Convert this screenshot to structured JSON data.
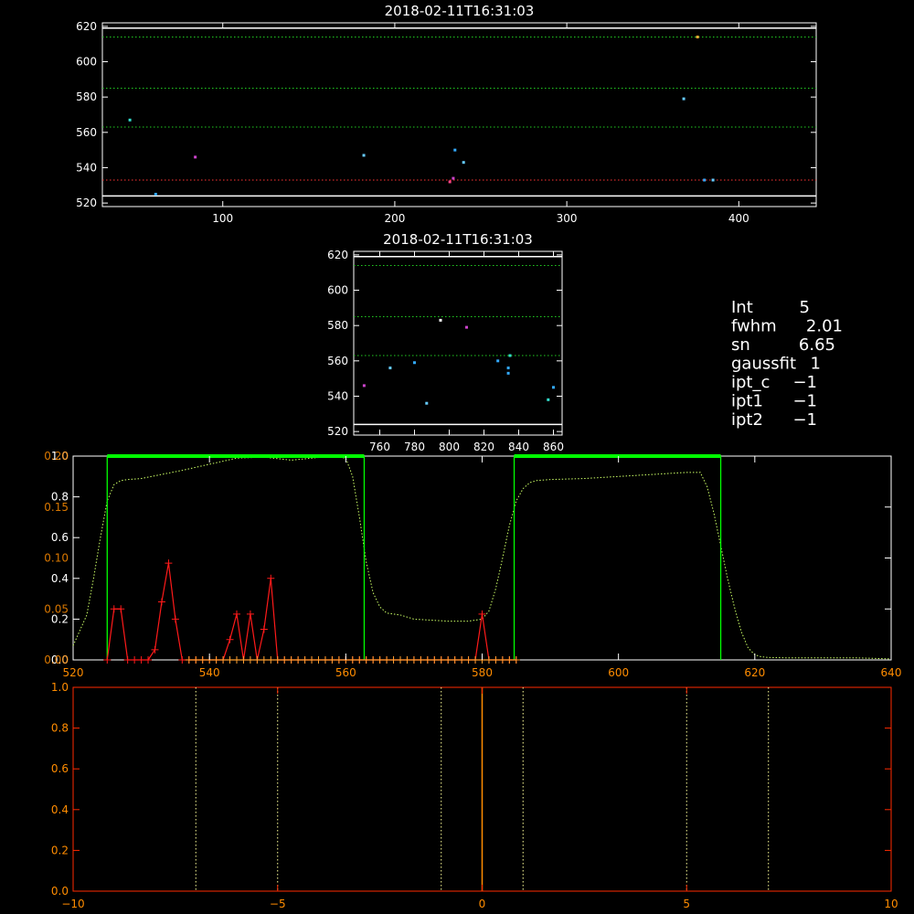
{
  "colors": {
    "background": "#000000",
    "axis_white": "#ffffff",
    "axis_red": "#ff2a00",
    "axis_orange": "#ff8c00",
    "green_bright": "#00ff00",
    "green_dotted": "#22cc22",
    "yellow_green": "#ccff66",
    "red_line": "#ff1a1a",
    "orange_line": "#ffa030",
    "red_dotted": "#ff3333",
    "white_dotted": "#ffff99"
  },
  "stats": {
    "rows": [
      {
        "label": "Int",
        "value": "5"
      },
      {
        "label": "fwhm",
        "value": "2.01"
      },
      {
        "label": "sn",
        "value": "6.65"
      },
      {
        "label": "gaussfit",
        "value": "1"
      },
      {
        "label": "ipt_c",
        "value": "−1"
      },
      {
        "label": "ipt1",
        "value": "−1"
      },
      {
        "label": "ipt2",
        "value": "−1"
      }
    ]
  },
  "chart_data": [
    {
      "type": "scatter",
      "title": "2018-02-11T16:31:03",
      "xlim": [
        30,
        445
      ],
      "ylim": [
        518,
        622
      ],
      "xticks": [
        100,
        200,
        300,
        400
      ],
      "yticks": [
        520,
        540,
        560,
        580,
        600,
        620
      ],
      "hlines": [
        {
          "y": 614,
          "color": "#22cc22",
          "style": "dotted"
        },
        {
          "y": 585,
          "color": "#22cc22",
          "style": "dotted"
        },
        {
          "y": 563,
          "color": "#22cc22",
          "style": "dotted"
        },
        {
          "y": 533,
          "color": "#ff3333",
          "style": "dotted"
        },
        {
          "y": 524,
          "color": "#ffffff",
          "style": "solid"
        },
        {
          "y": 619,
          "color": "#ffffff",
          "style": "solid"
        }
      ],
      "points": [
        {
          "x": 46,
          "y": 567,
          "color": "#33ddcc"
        },
        {
          "x": 61,
          "y": 525,
          "color": "#33aaff"
        },
        {
          "x": 84,
          "y": 546,
          "color": "#cc44cc"
        },
        {
          "x": 182,
          "y": 547,
          "color": "#66ccff"
        },
        {
          "x": 232,
          "y": 532,
          "color": "#ff4488"
        },
        {
          "x": 234,
          "y": 534,
          "color": "#cc44cc"
        },
        {
          "x": 235,
          "y": 550,
          "color": "#33aaff"
        },
        {
          "x": 240,
          "y": 543,
          "color": "#66ccff"
        },
        {
          "x": 368,
          "y": 579,
          "color": "#66ccff"
        },
        {
          "x": 376,
          "y": 614,
          "color": "#ffaa33"
        },
        {
          "x": 380,
          "y": 533,
          "color": "#33aaff"
        },
        {
          "x": 385,
          "y": 533,
          "color": "#66ccff"
        }
      ]
    },
    {
      "type": "scatter",
      "title": "2018-02-11T16:31:03",
      "xlim": [
        745,
        865
      ],
      "ylim": [
        518,
        622
      ],
      "xticks": [
        760,
        780,
        800,
        820,
        840,
        860
      ],
      "yticks": [
        520,
        540,
        560,
        580,
        600,
        620
      ],
      "hlines": [
        {
          "y": 614,
          "color": "#22cc22",
          "style": "dotted"
        },
        {
          "y": 585,
          "color": "#22cc22",
          "style": "dotted"
        },
        {
          "y": 563,
          "color": "#22cc22",
          "style": "dotted"
        },
        {
          "y": 524,
          "color": "#ffffff",
          "style": "solid"
        },
        {
          "y": 619,
          "color": "#ffffff",
          "style": "solid"
        }
      ],
      "points": [
        {
          "x": 751,
          "y": 546,
          "color": "#cc44cc"
        },
        {
          "x": 766,
          "y": 556,
          "color": "#66ccff"
        },
        {
          "x": 780,
          "y": 559,
          "color": "#33aaff"
        },
        {
          "x": 787,
          "y": 536,
          "color": "#66ccff"
        },
        {
          "x": 795,
          "y": 583,
          "color": "#ffffff"
        },
        {
          "x": 810,
          "y": 579,
          "color": "#cc44cc"
        },
        {
          "x": 828,
          "y": 560,
          "color": "#33aaff"
        },
        {
          "x": 834,
          "y": 553,
          "color": "#33aaff"
        },
        {
          "x": 834,
          "y": 556,
          "color": "#33aaff"
        },
        {
          "x": 835,
          "y": 563,
          "color": "#33ddcc"
        },
        {
          "x": 857,
          "y": 538,
          "color": "#33ddcc"
        },
        {
          "x": 860,
          "y": 545,
          "color": "#33aaff"
        }
      ]
    },
    {
      "type": "line",
      "xlim": [
        520,
        640
      ],
      "ylim_left": [
        0,
        1.0
      ],
      "ylim_right": [
        0,
        0.2
      ],
      "xticks": [
        520,
        540,
        560,
        580,
        600,
        620,
        640
      ],
      "yticks_left": [
        0.0,
        0.2,
        0.4,
        0.6,
        0.8,
        1.0
      ],
      "yticklabels_left": [
        "0.0",
        "0.2",
        "0.4",
        "0.6",
        "0.8",
        "1.0"
      ],
      "yticks_right": [
        0.0,
        0.05,
        0.1,
        0.15,
        0.2
      ],
      "yticklabels_right": [
        "0.00",
        "0.05",
        "0.10",
        "0.15",
        "0.20"
      ],
      "bandpass_windows": [
        {
          "x0": 525.0,
          "x1": 562.7
        },
        {
          "x0": 584.7,
          "x1": 615.0
        }
      ],
      "transmission_curve": {
        "x": [
          520,
          522,
          523,
          524,
          525,
          526,
          527,
          528,
          530,
          533,
          536,
          540,
          544,
          548,
          552,
          555,
          558,
          560,
          561,
          562,
          563,
          564,
          565,
          566,
          568,
          570,
          575,
          578,
          580,
          581,
          582,
          583,
          584,
          585,
          586,
          587,
          588,
          590,
          595,
          600,
          605,
          610,
          612,
          613,
          614,
          615,
          616,
          617,
          618,
          619,
          620,
          621,
          622,
          625,
          630,
          635,
          640
        ],
        "y": [
          0.07,
          0.22,
          0.4,
          0.6,
          0.78,
          0.86,
          0.88,
          0.885,
          0.89,
          0.91,
          0.93,
          0.96,
          0.99,
          0.995,
          0.98,
          0.99,
          1.0,
          0.99,
          0.9,
          0.7,
          0.48,
          0.33,
          0.26,
          0.23,
          0.22,
          0.2,
          0.19,
          0.19,
          0.2,
          0.24,
          0.35,
          0.5,
          0.66,
          0.78,
          0.84,
          0.87,
          0.88,
          0.885,
          0.89,
          0.9,
          0.91,
          0.92,
          0.92,
          0.85,
          0.72,
          0.56,
          0.4,
          0.26,
          0.14,
          0.06,
          0.025,
          0.015,
          0.012,
          0.01,
          0.01,
          0.01,
          0.005
        ]
      },
      "series": [
        {
          "color": "#ff1a1a",
          "x": [
            525,
            526,
            527,
            528,
            529,
            530,
            531,
            532,
            533,
            534,
            535,
            536,
            537,
            538,
            539,
            540,
            541,
            542,
            543,
            544,
            545,
            546,
            547,
            548,
            549,
            550,
            551,
            552,
            553,
            554,
            555,
            556,
            557,
            558,
            559,
            560,
            561,
            562,
            563,
            564,
            565,
            566,
            567,
            568,
            569,
            570,
            571,
            572,
            573,
            574,
            575,
            576,
            577,
            578,
            579,
            580,
            581,
            582,
            583,
            584,
            585
          ],
          "y": [
            0.0,
            0.05,
            0.05,
            0.0,
            0.0,
            0.0,
            0.0,
            0.01,
            0.057,
            0.095,
            0.04,
            0.0,
            0.0,
            0.0,
            0.0,
            0.0,
            0.0,
            0.0,
            0.02,
            0.045,
            0.0,
            0.045,
            0.0,
            0.03,
            0.08,
            0.0,
            0.0,
            0.0,
            0.0,
            0.0,
            0.0,
            0.0,
            0.0,
            0.0,
            0.0,
            0.0,
            0.0,
            0.0,
            0.0,
            0.0,
            0.0,
            0.0,
            0.0,
            0.0,
            0.0,
            0.0,
            0.0,
            0.0,
            0.0,
            0.0,
            0.0,
            0.0,
            0.0,
            0.0,
            0.0,
            0.045,
            0.0,
            0.0,
            0.0,
            0.0,
            0.0
          ]
        },
        {
          "color": "#ffa030",
          "x": [
            537,
            538,
            539,
            540,
            541,
            542,
            543,
            544,
            545,
            546,
            547,
            548,
            549,
            550,
            551,
            552,
            553,
            554,
            555,
            556,
            557,
            558,
            559,
            560,
            561,
            562,
            563,
            564,
            565,
            566,
            567,
            568,
            569,
            570,
            571,
            572,
            573,
            574,
            575,
            576,
            577,
            578,
            579,
            580,
            581,
            582,
            583,
            584,
            585
          ],
          "y": [
            0.0,
            0.0,
            0.0,
            0.0,
            0.0,
            0.0,
            0.0,
            0.0,
            0.0,
            0.0,
            0.0,
            0.0,
            0.0,
            0.0,
            0.0,
            0.0,
            0.0,
            0.0,
            0.0,
            0.0,
            0.0,
            0.0,
            0.0,
            0.0,
            0.0,
            0.0,
            0.0,
            0.0,
            0.0,
            0.0,
            0.0,
            0.0,
            0.0,
            0.0,
            0.0,
            0.0,
            0.0,
            0.0,
            0.0,
            0.0,
            0.0,
            0.0,
            0.0,
            0.0,
            0.0,
            0.0,
            0.0,
            0.0,
            0.0
          ]
        }
      ]
    },
    {
      "type": "line",
      "xlim": [
        -10,
        10
      ],
      "ylim": [
        0,
        1.0
      ],
      "xticks": [
        -10,
        -5,
        0,
        5,
        10
      ],
      "yticks": [
        0.0,
        0.2,
        0.4,
        0.6,
        0.8,
        1.0
      ],
      "yticklabels": [
        "0.0",
        "0.2",
        "0.4",
        "0.6",
        "0.8",
        "1.0"
      ],
      "vlines_dotted": [
        -7.0,
        -5.0,
        -1.0,
        1.0,
        5.0,
        7.0
      ],
      "vline_solid": 0.0
    }
  ]
}
